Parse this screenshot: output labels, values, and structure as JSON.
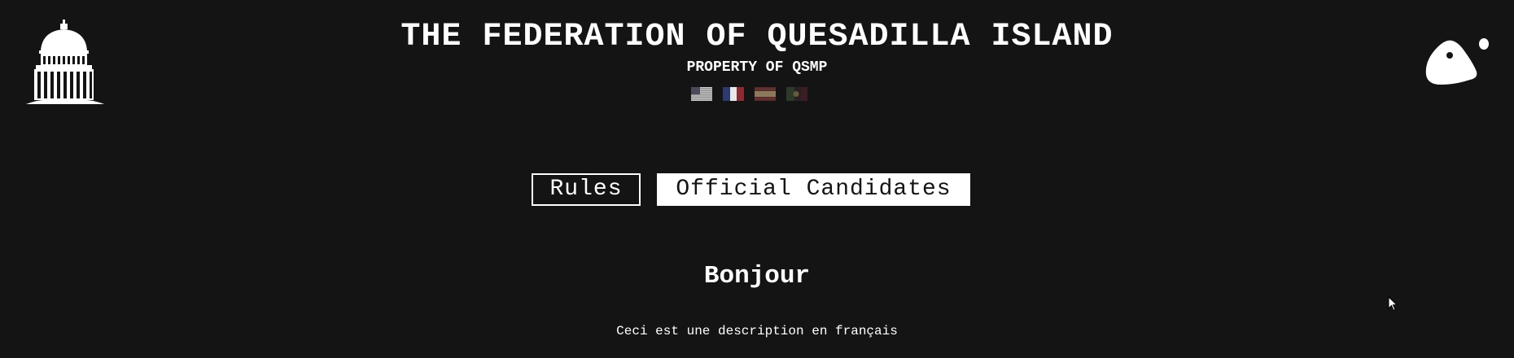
{
  "header": {
    "title": "THE FEDERATION OF QUESADILLA ISLAND",
    "subtitle": "PROPERTY OF QSMP",
    "left_logo_icon": "capitol-building-icon",
    "right_logo_icon": "qsmp-egg-logo-icon"
  },
  "languages": [
    {
      "flag_icon": "usa-flag-icon"
    },
    {
      "flag_icon": "france-flag-icon"
    },
    {
      "flag_icon": "spain-flag-icon"
    },
    {
      "flag_icon": "brazil-flag-icon"
    }
  ],
  "tabs": {
    "rules_label": "Rules",
    "candidates_label": "Official Candidates",
    "active": "Official Candidates"
  },
  "content": {
    "heading": "Bonjour",
    "description": "Ceci est une description en français"
  },
  "colors": {
    "background": "#141414",
    "foreground": "#ffffff"
  }
}
